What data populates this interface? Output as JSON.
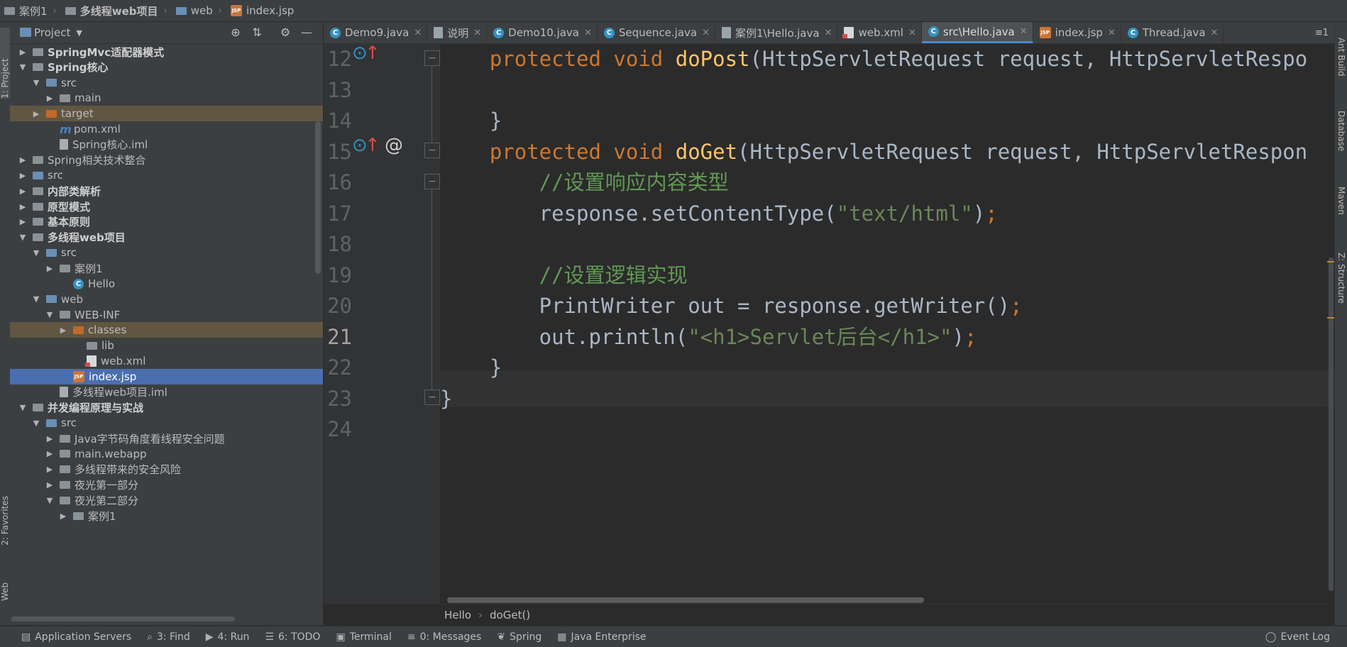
{
  "breadcrumb": [
    "案例1",
    "多线程web项目",
    "web",
    "index.jsp"
  ],
  "project_panel": {
    "title": "Project",
    "tree": [
      {
        "label": "SpringMvc适配器模式",
        "level": 1,
        "arrow": "▶",
        "bold": true,
        "icon": "module-folder"
      },
      {
        "label": "Spring核心",
        "level": 1,
        "arrow": "▼",
        "bold": true,
        "icon": "module-folder"
      },
      {
        "label": "src",
        "level": 2,
        "arrow": "▼",
        "icon": "source-folder"
      },
      {
        "label": "main",
        "level": 3,
        "arrow": "▶",
        "icon": "folder"
      },
      {
        "label": "target",
        "level": 2,
        "arrow": "▶",
        "icon": "excluded-folder",
        "highlight": true
      },
      {
        "label": "pom.xml",
        "level": 3,
        "icon": "maven-file"
      },
      {
        "label": "Spring核心.iml",
        "level": 3,
        "icon": "iml-file"
      },
      {
        "label": "Spring相关技术整合",
        "level": 1,
        "arrow": "▶",
        "icon": "module-folder"
      },
      {
        "label": "src",
        "level": 1,
        "arrow": "▶",
        "icon": "source-folder"
      },
      {
        "label": "内部类解析",
        "level": 1,
        "arrow": "▶",
        "bold": true,
        "icon": "module-folder"
      },
      {
        "label": "原型模式",
        "level": 1,
        "arrow": "▶",
        "bold": true,
        "icon": "module-folder"
      },
      {
        "label": "基本原则",
        "level": 1,
        "arrow": "▶",
        "bold": true,
        "icon": "module-folder"
      },
      {
        "label": "多线程web项目",
        "level": 1,
        "arrow": "▼",
        "bold": true,
        "icon": "module-folder"
      },
      {
        "label": "src",
        "level": 2,
        "arrow": "▼",
        "icon": "source-folder"
      },
      {
        "label": "案例1",
        "level": 3,
        "arrow": "▶",
        "icon": "package"
      },
      {
        "label": "Hello",
        "level": 4,
        "icon": "class"
      },
      {
        "label": "web",
        "level": 2,
        "arrow": "▼",
        "icon": "web-folder"
      },
      {
        "label": "WEB-INF",
        "level": 3,
        "arrow": "▼",
        "icon": "folder"
      },
      {
        "label": "classes",
        "level": 4,
        "arrow": "▶",
        "icon": "excluded-folder",
        "highlight": true
      },
      {
        "label": "lib",
        "level": 5,
        "icon": "folder"
      },
      {
        "label": "web.xml",
        "level": 5,
        "icon": "xml-file"
      },
      {
        "label": "index.jsp",
        "level": 4,
        "icon": "jsp-file",
        "selected": true
      },
      {
        "label": "多线程web项目.iml",
        "level": 3,
        "icon": "iml-file"
      },
      {
        "label": "并发编程原理与实战",
        "level": 1,
        "arrow": "▼",
        "bold": true,
        "icon": "module-folder"
      },
      {
        "label": "src",
        "level": 2,
        "arrow": "▼",
        "icon": "source-folder"
      },
      {
        "label": "Java字节码角度看线程安全问题",
        "level": 3,
        "arrow": "▶",
        "icon": "package"
      },
      {
        "label": "main.webapp",
        "level": 3,
        "arrow": "▶",
        "icon": "package"
      },
      {
        "label": "多线程带来的安全风险",
        "level": 3,
        "arrow": "▶",
        "icon": "package"
      },
      {
        "label": "夜光第一部分",
        "level": 3,
        "arrow": "▶",
        "icon": "package"
      },
      {
        "label": "夜光第二部分",
        "level": 3,
        "arrow": "▼",
        "icon": "package"
      },
      {
        "label": "案例1",
        "level": 4,
        "arrow": "▶",
        "icon": "package"
      }
    ]
  },
  "tabs": [
    {
      "label": "Demo9.java",
      "icon": "class"
    },
    {
      "label": "说明",
      "icon": "doc"
    },
    {
      "label": "Demo10.java",
      "icon": "class"
    },
    {
      "label": "Sequence.java",
      "icon": "class"
    },
    {
      "label": "案例1\\Hello.java",
      "icon": "doc"
    },
    {
      "label": "web.xml",
      "icon": "xml"
    },
    {
      "label": "src\\Hello.java",
      "icon": "class",
      "active": true
    },
    {
      "label": "index.jsp",
      "icon": "jsp"
    },
    {
      "label": "Thread.java",
      "icon": "class"
    }
  ],
  "tab_menu_label": "≡1",
  "editor": {
    "current_line": "21",
    "lines": [
      {
        "n": "12",
        "tokens": [
          [
            "kw",
            "    protected void "
          ],
          [
            "fn",
            "doPost"
          ],
          [
            "",
            "(HttpServletRequest request, HttpServletRespo"
          ]
        ]
      },
      {
        "n": "13",
        "tokens": []
      },
      {
        "n": "14",
        "tokens": [
          [
            "",
            "    }"
          ]
        ]
      },
      {
        "n": "15",
        "tokens": [
          [
            "kw",
            "    protected void "
          ],
          [
            "fn",
            "doGet"
          ],
          [
            "",
            "(HttpServletRequest request, HttpServletRespon"
          ]
        ]
      },
      {
        "n": "16",
        "tokens": [
          [
            "cm",
            "        //设置响应内容类型"
          ]
        ]
      },
      {
        "n": "17",
        "tokens": [
          [
            "",
            "        response.setContentType("
          ],
          [
            "st",
            "\"text/html\""
          ],
          [
            "",
            ")"
          ],
          [
            "kw",
            ";"
          ]
        ]
      },
      {
        "n": "18",
        "tokens": []
      },
      {
        "n": "19",
        "tokens": [
          [
            "cm",
            "        //设置逻辑实现"
          ]
        ]
      },
      {
        "n": "20",
        "tokens": [
          [
            "",
            "        PrintWriter out = response.getWriter()"
          ],
          [
            "kw",
            ";"
          ]
        ]
      },
      {
        "n": "21",
        "tokens": [
          [
            "",
            "        out.println("
          ],
          [
            "st",
            "\"<h1>Servlet后台</h1>\""
          ],
          [
            "",
            ")"
          ],
          [
            "kw",
            ";"
          ]
        ]
      },
      {
        "n": "22",
        "tokens": [
          [
            "",
            "    }"
          ]
        ]
      },
      {
        "n": "23",
        "tokens": [
          [
            "",
            "}"
          ]
        ]
      },
      {
        "n": "24",
        "tokens": []
      }
    ]
  },
  "editor_breadcrumb": [
    "Hello",
    "doGet()"
  ],
  "left_tool_windows": [
    "1: Project",
    "2: Favorites",
    "Web"
  ],
  "right_tool_windows": [
    "Ant Build",
    "Database",
    "Maven",
    "Z: Structure"
  ],
  "statusbar": {
    "items": [
      {
        "label": "Application Servers",
        "icon": "server-icon"
      },
      {
        "label": "3: Find",
        "icon": "search-icon"
      },
      {
        "label": "4: Run",
        "icon": "run-icon"
      },
      {
        "label": "6: TODO",
        "icon": "todo-icon"
      },
      {
        "label": "Terminal",
        "icon": "terminal-icon"
      },
      {
        "label": "0: Messages",
        "icon": "messages-icon"
      },
      {
        "label": "Spring",
        "icon": "spring-icon"
      },
      {
        "label": "Java Enterprise",
        "icon": "java-enterprise-icon"
      }
    ],
    "event_log": "Event Log"
  },
  "colors": {
    "background": "#2b2b2b",
    "panel": "#3c3f41",
    "selection": "#4b6eaf",
    "keyword": "#cc7832",
    "method": "#ffc66d",
    "comment": "#629755",
    "string": "#6a8759"
  }
}
